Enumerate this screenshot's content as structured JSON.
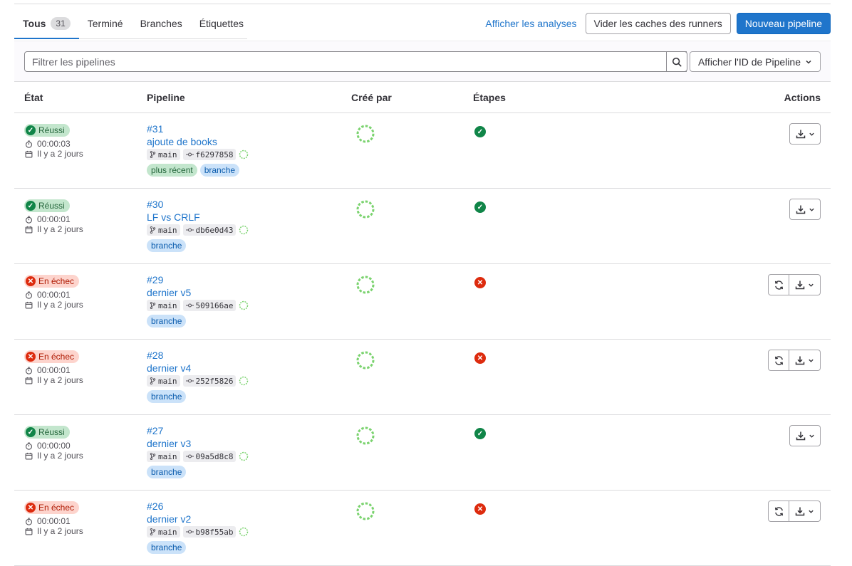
{
  "tabs": [
    {
      "label": "Tous",
      "count": "31"
    },
    {
      "label": "Terminé"
    },
    {
      "label": "Branches"
    },
    {
      "label": "Étiquettes"
    }
  ],
  "header": {
    "analytics_link": "Afficher les analyses",
    "clear_cache_button": "Vider les caches des runners",
    "new_pipeline_button": "Nouveau pipeline"
  },
  "filter": {
    "placeholder": "Filtrer les pipelines",
    "dropdown_label": "Afficher l'ID de Pipeline"
  },
  "columns": {
    "status": "État",
    "pipeline": "Pipeline",
    "created_by": "Créé par",
    "stages": "Étapes",
    "actions": "Actions"
  },
  "rows": [
    {
      "status": "Réussi",
      "state": "success",
      "duration": "00:00:03",
      "finished": "Il y a 2 jours",
      "id": "#31",
      "title": "ajoute de books",
      "branch": "main",
      "commit": "f6297858",
      "tags": [
        "plus récent",
        "branche"
      ],
      "stage": "success",
      "retry": false
    },
    {
      "status": "Réussi",
      "state": "success",
      "duration": "00:00:01",
      "finished": "Il y a 2 jours",
      "id": "#30",
      "title": "LF vs CRLF",
      "branch": "main",
      "commit": "db6e0d43",
      "tags": [
        "branche"
      ],
      "stage": "success",
      "retry": false
    },
    {
      "status": "En échec",
      "state": "failed",
      "duration": "00:00:01",
      "finished": "Il y a 2 jours",
      "id": "#29",
      "title": "dernier v5",
      "branch": "main",
      "commit": "509166ae",
      "tags": [
        "branche"
      ],
      "stage": "failed",
      "retry": true
    },
    {
      "status": "En échec",
      "state": "failed",
      "duration": "00:00:01",
      "finished": "Il y a 2 jours",
      "id": "#28",
      "title": "dernier v4",
      "branch": "main",
      "commit": "252f5826",
      "tags": [
        "branche"
      ],
      "stage": "failed",
      "retry": true
    },
    {
      "status": "Réussi",
      "state": "success",
      "duration": "00:00:00",
      "finished": "Il y a 2 jours",
      "id": "#27",
      "title": "dernier v3",
      "branch": "main",
      "commit": "09a5d8c8",
      "tags": [
        "branche"
      ],
      "stage": "success",
      "retry": false
    },
    {
      "status": "En échec",
      "state": "failed",
      "duration": "00:00:01",
      "finished": "Il y a 2 jours",
      "id": "#26",
      "title": "dernier v2",
      "branch": "main",
      "commit": "b98f55ab",
      "tags": [
        "branche"
      ],
      "stage": "failed",
      "retry": true
    }
  ],
  "colors": {
    "accent": "#1f75cb",
    "success": "#108548",
    "failed": "#dd2b0e",
    "avatar": "#7bd36f"
  },
  "icons": {
    "search": "search-icon",
    "chevron": "chevron-down-icon",
    "clock": "timer-icon",
    "calendar": "calendar-icon",
    "branch": "branch-icon",
    "commit": "commit-icon",
    "download": "download-icon",
    "retry": "retry-icon"
  }
}
